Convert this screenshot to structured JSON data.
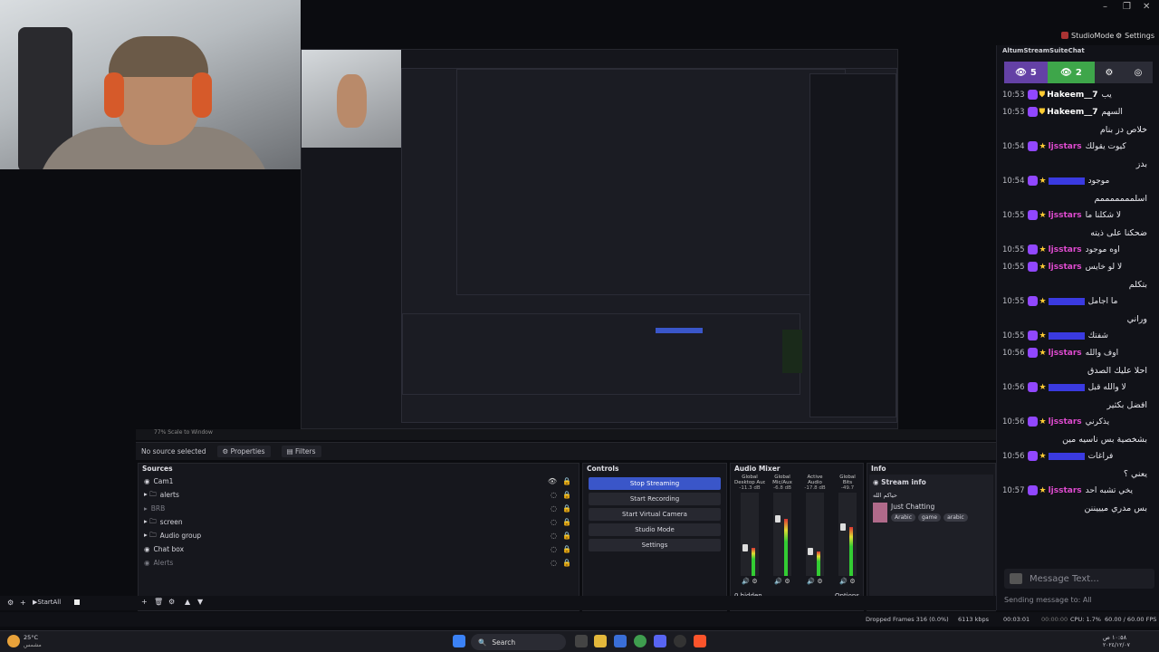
{
  "window_controls": {
    "minimize": "–",
    "restore": "❐",
    "close": "✕"
  },
  "top_buttons": {
    "studio_mode": "StudioMode",
    "settings": "Settings"
  },
  "chat": {
    "title": "AltumStreamSuiteChat",
    "viewers": "5",
    "followers": "2",
    "messages": [
      {
        "time": "10:53",
        "user": "Hakeem__7",
        "text": "يب",
        "user_color": "#ffffff",
        "badge": "green-shield"
      },
      {
        "time": "10:53",
        "user": "Hakeem__7",
        "text": "السهم",
        "user_color": "#ffffff",
        "badge": "green-shield",
        "extra": "خلاص دز بنام"
      },
      {
        "time": "10:54",
        "user": "ljsstars",
        "text": "كيوت يقولك",
        "user_color": "#e04bd0",
        "badge": "star",
        "extra": "بدز"
      },
      {
        "time": "10:54",
        "user": "",
        "text": "موجود",
        "user_color": "#3a3ae0",
        "badge": "star",
        "extra": "اسلمممممممم"
      },
      {
        "time": "10:55",
        "user": "ljsstars",
        "text": "لا شكلنا ما",
        "user_color": "#e04bd0",
        "badge": "star",
        "extra": "ضحكنا على ذيته"
      },
      {
        "time": "10:55",
        "user": "ljsstars",
        "text": "اوه موجود",
        "user_color": "#e04bd0",
        "badge": "star"
      },
      {
        "time": "10:55",
        "user": "ljsstars",
        "text": "لا لو خايس",
        "user_color": "#e04bd0",
        "badge": "star",
        "extra": "بتكلم"
      },
      {
        "time": "10:55",
        "user": "",
        "text": "ما اجامل",
        "user_color": "#3a3ae0",
        "badge": "star",
        "extra": "وراني"
      },
      {
        "time": "10:55",
        "user": "",
        "text": "شفتك",
        "user_color": "#3a3ae0",
        "badge": "star"
      },
      {
        "time": "10:56",
        "user": "ljsstars",
        "text": "اوف والله",
        "user_color": "#e04bd0",
        "badge": "star",
        "extra": "احلا عليك الصدق"
      },
      {
        "time": "10:56",
        "user": "",
        "text": "لا والله قبل",
        "user_color": "#3a3ae0",
        "badge": "star",
        "extra": "افضل بكثير"
      },
      {
        "time": "10:56",
        "user": "ljsstars",
        "text": "يذكرني",
        "user_color": "#e04bd0",
        "badge": "star",
        "extra": "بشخصية بس ناسيه مين"
      },
      {
        "time": "10:56",
        "user": "",
        "text": "فراغات",
        "user_color": "#3a3ae0",
        "badge": "star",
        "extra": "يعني ؟"
      },
      {
        "time": "10:57",
        "user": "ljsstars",
        "text": "يخي تشبه احد",
        "user_color": "#e04bd0",
        "badge": "star",
        "extra": "بس مدري ميييننن"
      }
    ],
    "input_placeholder": "Message Text...",
    "sending_to": "Sending message to: All"
  },
  "obs": {
    "status_row": "77%   Scale to Window",
    "no_source": "No source selected",
    "properties": "Properties",
    "filters": "Filters",
    "sources_title": "Sources",
    "sources": [
      {
        "name": "Cam1",
        "dim": false,
        "kind": "camera"
      },
      {
        "name": "alerts",
        "dim": false,
        "kind": "folder"
      },
      {
        "name": "BRB",
        "dim": true,
        "kind": "group"
      },
      {
        "name": "screen",
        "dim": false,
        "kind": "folder"
      },
      {
        "name": "Audio group",
        "dim": false,
        "kind": "folder"
      },
      {
        "name": "Chat box",
        "dim": false,
        "kind": "browser"
      },
      {
        "name": "Alerts",
        "dim": true,
        "kind": "browser"
      }
    ],
    "controls_title": "Controls",
    "controls": [
      "Stop Streaming",
      "Start Recording",
      "Start Virtual Camera",
      "Studio Mode",
      "Settings"
    ],
    "mixer_title": "Audio Mixer",
    "mixer_channels": [
      {
        "scope": "Global",
        "name": "Desktop Audio",
        "db": "-11.3 dB",
        "level": 0.35
      },
      {
        "scope": "Global",
        "name": "Mic/Aux",
        "db": "-6.8 dB",
        "level": 0.7
      },
      {
        "scope": "Active",
        "name": "Audio",
        "db": "-17.8 dB",
        "level": 0.3
      },
      {
        "scope": "Global",
        "name": "Bits",
        "db": "-49.7",
        "level": 0.6
      }
    ],
    "mixer_hidden": "0 hidden",
    "mixer_options": "Options",
    "info_title": "Info",
    "stream_info": "Stream info",
    "stream_title": "حياكم الله",
    "category": "Just Chatting",
    "tags": [
      "Arabic",
      "game",
      "arabic"
    ],
    "startall": "StartAll",
    "statusbar": {
      "dropped": "Dropped Frames 316 (0.0%)",
      "kbps": "6113 kbps",
      "live": "00:03:01",
      "rec": "00:00:00",
      "cpu": "CPU: 1.7%",
      "fps": "60.00 / 60.00 FPS"
    }
  },
  "taskbar": {
    "weather": "25°C",
    "weather_sub": "مشمس",
    "search": "Search",
    "time": "١٠:٥٨ ص",
    "date": "٢٠٢٤/١٢/٠٧"
  },
  "colors": {
    "accent": "#9147ff",
    "viewers_bg": "#6441a5",
    "followers_bg": "#3ea64a",
    "stream_btn": "#3a56c9"
  }
}
